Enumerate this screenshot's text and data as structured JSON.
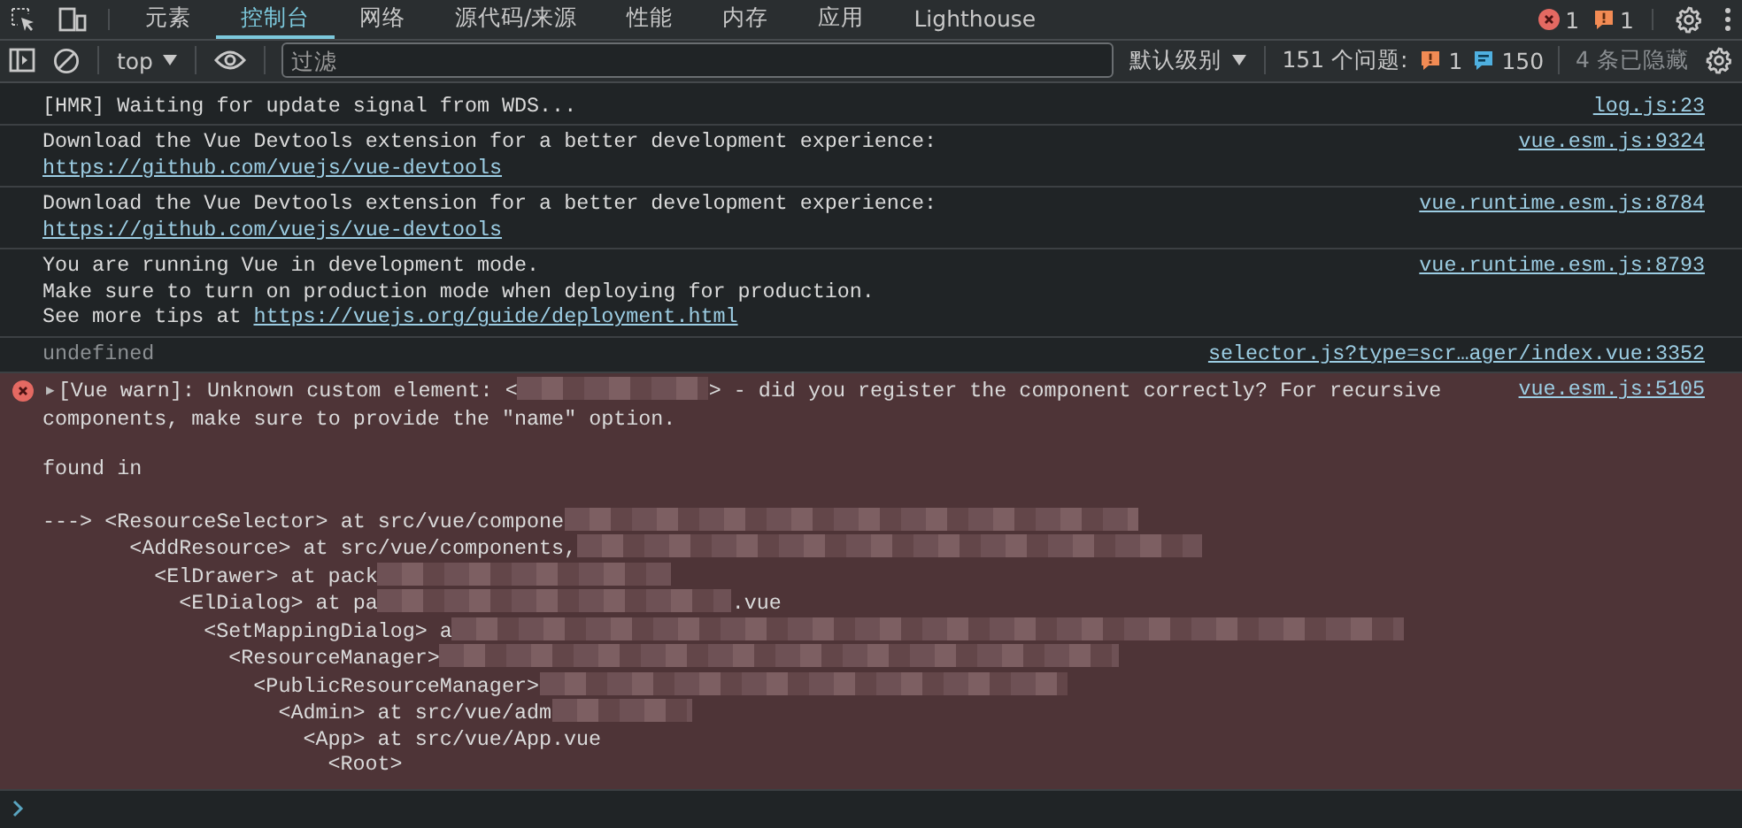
{
  "tabs_bar": {
    "tabs": [
      {
        "label": "元素",
        "selected": false
      },
      {
        "label": "控制台",
        "selected": true
      },
      {
        "label": "网络",
        "selected": false
      },
      {
        "label": "源代码/来源",
        "selected": false
      },
      {
        "label": "性能",
        "selected": false
      },
      {
        "label": "内存",
        "selected": false
      },
      {
        "label": "应用",
        "selected": false
      },
      {
        "label": "Lighthouse",
        "selected": false
      }
    ],
    "error_count": "1",
    "warning_count": "1"
  },
  "filter_bar": {
    "context": "top",
    "filter": {
      "placeholder": "过滤"
    },
    "level": "默认级别",
    "issues_label": "151 个问题:",
    "issue_warnings": "1",
    "issue_info": "150",
    "hidden": "4 条已隐藏"
  },
  "messages": [
    {
      "kind": "log",
      "lines": [
        [
          {
            "kind": "text",
            "text": "[HMR] Waiting for update signal from WDS..."
          }
        ]
      ],
      "source": "log.js:23"
    },
    {
      "kind": "log",
      "lines": [
        [
          {
            "kind": "text",
            "text": "Download the Vue Devtools extension for a better development experience:"
          }
        ],
        [
          {
            "kind": "link",
            "text": "https://github.com/vuejs/vue-devtools"
          }
        ]
      ],
      "source": "vue.esm.js:9324"
    },
    {
      "kind": "log",
      "lines": [
        [
          {
            "kind": "text",
            "text": "Download the Vue Devtools extension for a better development experience:"
          }
        ],
        [
          {
            "kind": "link",
            "text": "https://github.com/vuejs/vue-devtools"
          }
        ]
      ],
      "source": "vue.runtime.esm.js:8784"
    },
    {
      "kind": "log",
      "lines": [
        [
          {
            "kind": "text",
            "text": "You are running Vue in development mode."
          }
        ],
        [
          {
            "kind": "text",
            "text": "Make sure to turn on production mode when deploying for production."
          }
        ],
        [
          {
            "kind": "text",
            "text": "See more tips at "
          },
          {
            "kind": "link",
            "text": "https://vuejs.org/guide/deployment.html"
          }
        ]
      ],
      "source": "vue.runtime.esm.js:8793"
    },
    {
      "kind": "result",
      "lines": [
        [
          {
            "kind": "text",
            "text": "undefined"
          }
        ]
      ],
      "source": "selector.js?type=scr…ager/index.vue:3352"
    },
    {
      "kind": "error",
      "toggle": "▶",
      "lines": [
        [
          {
            "kind": "text",
            "text": "[Vue warn]: Unknown custom element: <"
          },
          {
            "kind": "redacted"
          },
          {
            "kind": "text",
            "text": "> - did you register the component correctly? For recursive"
          }
        ],
        [
          {
            "kind": "text",
            "text": "components, make sure to provide the \"name\" option."
          }
        ]
      ],
      "source": "vue.esm.js:5105",
      "found_in": "found in",
      "stack": {
        "text": "---> <ResourceSelector> at src/vue/compone",
        "redacted": true,
        "children": [
          {
            "text": "<AddResource> at src/vue/components,",
            "redacted": true,
            "children": [
              {
                "text": "<ElDrawer> at pack",
                "redacted": true,
                "children": [
                  {
                    "text": "<ElDialog> at pa",
                    "redacted": true,
                    "after": ".vue",
                    "children": [
                      {
                        "text": "<SetMappingDialog> a",
                        "redacted": true,
                        "children": [
                          {
                            "text": "<ResourceManager>",
                            "redacted": true,
                            "children": [
                              {
                                "text": "<PublicResourceManager>",
                                "redacted": true,
                                "children": [
                                  {
                                    "text": "<Admin> at src/vue/adm",
                                    "redacted": true,
                                    "children": [
                                      {
                                        "text": "<App> at src/vue/App.vue",
                                        "redacted": false,
                                        "children": [
                                          {
                                            "text": "<Root>",
                                            "redacted": false
                                          }
                                        ]
                                      }
                                    ]
                                  }
                                ]
                              }
                            ]
                          }
                        ]
                      }
                    ]
                  }
                ]
              }
            ]
          }
        ]
      }
    }
  ]
}
